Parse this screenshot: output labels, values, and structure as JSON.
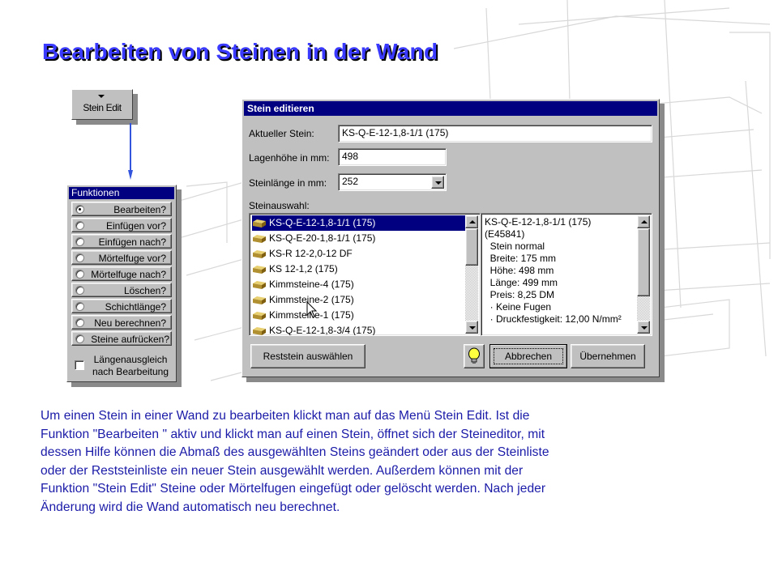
{
  "slide": {
    "title": "Bearbeiten von Steinen in der Wand",
    "body_lines": [
      "Um einen Stein in einer Wand zu bearbeiten klickt man auf das Menü Stein Edit. Ist die",
      "Funktion \"Bearbeiten \" aktiv und klickt man auf einen Stein, öffnet sich der Steineditor, mit",
      "dessen Hilfe können die Abmaß des ausgewählten  Steins geändert oder aus der Steinliste",
      "oder der Reststeinliste ein neuer  Stein ausgewählt werden. Außerdem können mit der",
      "Funktion \"Stein Edit\" Steine oder Mörtelfugen eingefügt oder gelöscht werden. Nach jeder",
      "Änderung wird die Wand automatisch neu berechnet."
    ]
  },
  "stein_edit_menu": {
    "label": "Stein Edit"
  },
  "funktionen": {
    "title": "Funktionen",
    "options": [
      {
        "label": "Bearbeiten?",
        "selected": true
      },
      {
        "label": "Einfügen vor?",
        "selected": false
      },
      {
        "label": "Einfügen nach?",
        "selected": false
      },
      {
        "label": "Mörtelfuge vor?",
        "selected": false
      },
      {
        "label": "Mörtelfuge nach?",
        "selected": false
      },
      {
        "label": "Löschen?",
        "selected": false
      },
      {
        "label": "Schichtlänge?",
        "selected": false
      },
      {
        "label": "Neu berechnen?",
        "selected": false
      },
      {
        "label": "Steine aufrücken?",
        "selected": false
      }
    ],
    "checkbox": {
      "line1": "Längenausgleich",
      "line2": "nach Bearbeitung",
      "checked": false
    }
  },
  "dialog": {
    "title": "Stein editieren",
    "aktueller_stein_label": "Aktueller Stein:",
    "aktueller_stein_value": "KS-Q-E-12-1,8-1/1 (175)",
    "lagenhoehe_label": "Lagenhöhe in mm:",
    "lagenhoehe_value": "498",
    "steinlaenge_label": "Steinlänge in mm:",
    "steinlaenge_value": "252",
    "steinauswahl_label": "Steinauswahl:",
    "stones": [
      "KS-Q-E-12-1,8-1/1 (175)",
      "KS-Q-E-20-1,8-1/1 (175)",
      "KS-R 12-2,0-12 DF",
      "KS 12-1,2 (175)",
      "Kimmsteine-4 (175)",
      "Kimmsteine-2 (175)",
      "Kimmsteine-1 (175)",
      "KS-Q-E-12-1,8-3/4 (175)"
    ],
    "selected_stone_index": 0,
    "info_lines": [
      "KS-Q-E-12-1,8-1/1 (175)",
      "(E45841)",
      "  Stein normal",
      "  Breite: 175 mm",
      "  Höhe: 498 mm",
      "  Länge: 499 mm",
      "  Preis: 8,25 DM",
      "  · Keine Fugen",
      "  · Druckfestigkeit: 12,00 N/mm²"
    ],
    "buttons": {
      "reststein": "Reststein auswählen",
      "abbrechen": "Abbrechen",
      "uebernehmen": "Übernehmen"
    },
    "colors": {
      "titlebar": "#000080",
      "selection": "#000080",
      "face": "#c0c0c0"
    }
  },
  "icons": [
    "stone-brick-icon",
    "lightbulb-icon",
    "mouse-cursor-icon",
    "dropdown-arrow-icon"
  ]
}
